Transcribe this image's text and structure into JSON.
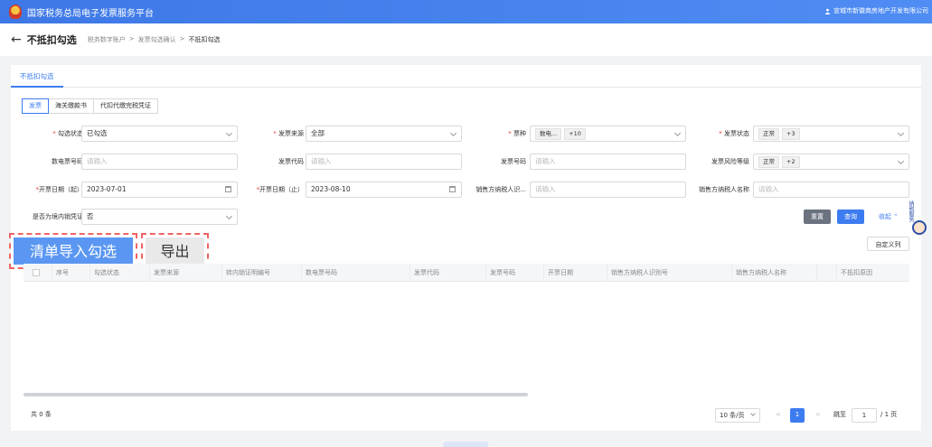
{
  "app": {
    "title": "国家税务总局电子发票服务平台",
    "user": "宣城市新徽商房地产开发有限公司"
  },
  "header": {
    "back": "←",
    "title": "不抵扣勾选",
    "breadcrumbs": [
      "税务数字账户",
      "发票勾选确认",
      "不抵扣勾选"
    ],
    "sep": ">"
  },
  "tab": "不抵扣勾选",
  "segments": [
    "发票",
    "海关缴款书",
    "代扣代缴完税凭证"
  ],
  "form": {
    "check_status": {
      "label": "勾选状态",
      "value": "已勾选"
    },
    "invoice_source": {
      "label": "发票来源",
      "value": "全部"
    },
    "invoice_type": {
      "label": "票种",
      "tags": [
        "数电...",
        "+10"
      ]
    },
    "invoice_status": {
      "label": "发票状态",
      "tags": [
        "正常",
        "+3"
      ]
    },
    "digital_no": {
      "label": "数电票号码",
      "placeholder": "请输入"
    },
    "invoice_code": {
      "label": "发票代码",
      "placeholder": "请输入"
    },
    "invoice_no": {
      "label": "发票号码",
      "placeholder": "请输入"
    },
    "risk_level": {
      "label": "发票风险等级",
      "tags": [
        "正常",
        "+2"
      ]
    },
    "date_start": {
      "label": "开票日期（起）",
      "value": "2023-07-01"
    },
    "date_end": {
      "label": "开票日期（止）",
      "value": "2023-08-10"
    },
    "seller_tax_id": {
      "label": "销售方纳税人识...",
      "placeholder": "请输入"
    },
    "seller_name": {
      "label": "销售方纳税人名称",
      "placeholder": "请输入"
    },
    "domestic_voucher": {
      "label": "是否为境内销凭证",
      "value": "否"
    },
    "required_mark": "*"
  },
  "buttons": {
    "reset": "重置",
    "query": "查询",
    "collapse": "收起 ⌃",
    "import": "清单导入勾选",
    "export": "导出",
    "custom_columns": "自定义列"
  },
  "table": {
    "columns": [
      "序号",
      "勾选状态",
      "发票来源",
      "转内销证明编号",
      "数电票号码",
      "发票代码",
      "发票号码",
      "开票日期",
      "销售方纳税人识别号",
      "销售方纳税人名称",
      "",
      "不抵扣原因"
    ]
  },
  "pagination": {
    "total": "共 0 条",
    "page_size": "10 条/页",
    "prev": "<",
    "current": "1",
    "next": ">",
    "jump_label": "跳至",
    "jump_value": "1",
    "total_pages": "/ 1 页"
  },
  "robot_label": "纳税服务"
}
